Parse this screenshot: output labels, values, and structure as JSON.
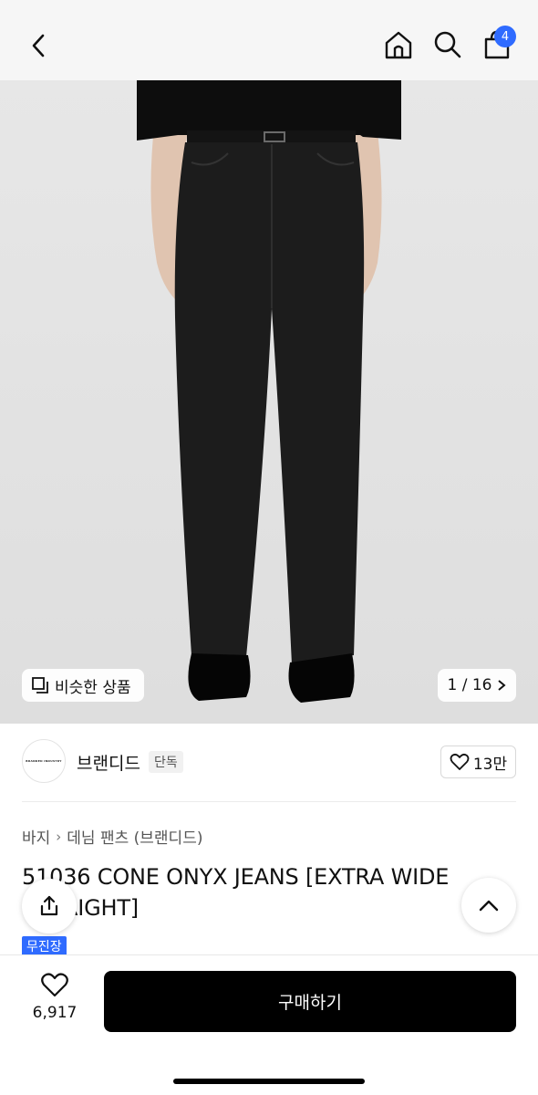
{
  "header": {
    "back_icon": "chevron-left-icon",
    "home_icon": "home-icon",
    "search_icon": "search-icon",
    "bag_icon": "shopping-bag-icon",
    "bag_badge": "4",
    "badge_color": "#2f6bff"
  },
  "gallery": {
    "similar_label": "비슷한 상품",
    "counter": "1 / 16"
  },
  "brand": {
    "logo_text": "BRANDED INDUSTRY",
    "name": "브랜디드",
    "tag": "단독",
    "likes": "13만"
  },
  "product": {
    "breadcrumb": [
      "바지",
      "데님 팬츠 (브랜디드)"
    ],
    "title": "51036 CONE ONYX JEANS [EXTRA WIDE STRAIGHT]",
    "shipping_badge": "무진장",
    "shipping_color": "#2f6bff"
  },
  "floating": {
    "share_icon": "share-icon",
    "top_icon": "chevron-up-icon"
  },
  "bottom": {
    "wish_count": "6,917",
    "buy_label": "구매하기"
  }
}
